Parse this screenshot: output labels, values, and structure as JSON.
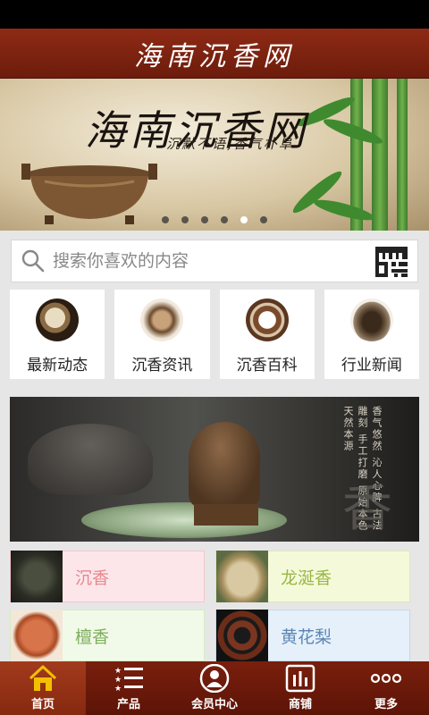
{
  "header": {
    "title": "海南沉香网"
  },
  "banner": {
    "title": "海南沉香网",
    "slogan": "沉默不语,香气朴阜",
    "slides": 6,
    "active_slide": 5
  },
  "search": {
    "placeholder": "搜索你喜欢的内容"
  },
  "categories": [
    {
      "label": "最新动态",
      "icon": "incense-sticks-thumb"
    },
    {
      "label": "沉香资讯",
      "icon": "agarwood-chip-thumb"
    },
    {
      "label": "沉香百科",
      "icon": "bead-bracelet-thumb"
    },
    {
      "label": "行业新闻",
      "icon": "agarwood-chunk-thumb"
    }
  ],
  "promo": {
    "calligraphy": "香气悠然 沁人心脾 古法雕刻 手工打磨 原始本色 天然本源",
    "char": "香"
  },
  "products": [
    {
      "label": "沉香",
      "bg": "#fde6ea",
      "color": "#e8888f"
    },
    {
      "label": "龙涎香",
      "bg": "#f4fad9",
      "color": "#9ab64a"
    },
    {
      "label": "檀香",
      "bg": "#f1fae8",
      "color": "#7fae5e"
    },
    {
      "label": "黄花梨",
      "bg": "#e5f0fb",
      "color": "#5d86b3"
    }
  ],
  "tabs": [
    {
      "label": "首页",
      "icon": "home-icon",
      "active": true
    },
    {
      "label": "产品",
      "icon": "product-list-icon",
      "active": false
    },
    {
      "label": "会员中心",
      "icon": "member-icon",
      "active": false
    },
    {
      "label": "商铺",
      "icon": "shop-chart-icon",
      "active": false
    },
    {
      "label": "更多",
      "icon": "more-dots-icon",
      "active": false
    }
  ],
  "colors": {
    "brand": "#7a1f0d",
    "accent": "#a23a1d"
  }
}
